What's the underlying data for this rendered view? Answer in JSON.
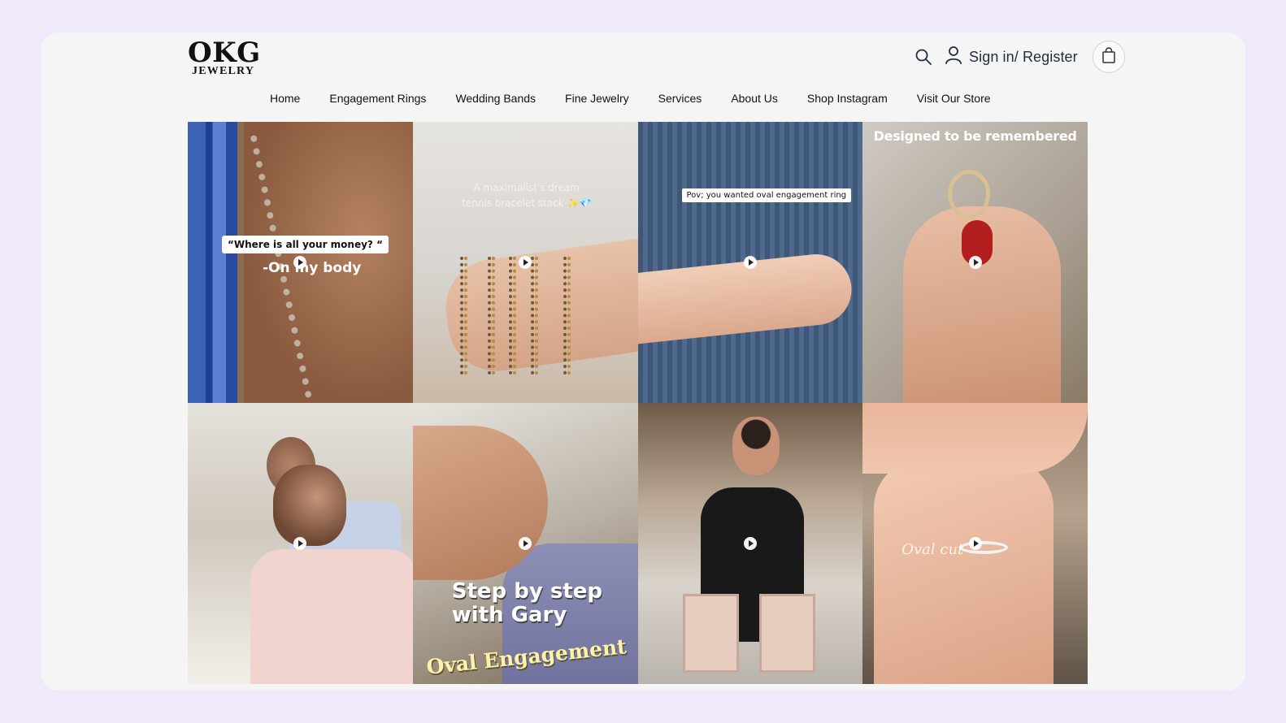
{
  "header": {
    "logo": {
      "line1": "OKG",
      "line2": "JEWELRY"
    },
    "account_label": "Sign in/ Register",
    "icons": {
      "search": "search-icon",
      "account": "user-icon",
      "cart": "shopping-bag-icon"
    }
  },
  "nav": {
    "items": [
      {
        "label": "Home"
      },
      {
        "label": "Engagement Rings"
      },
      {
        "label": "Wedding Bands"
      },
      {
        "label": "Fine Jewelry"
      },
      {
        "label": "Services"
      },
      {
        "label": "About Us"
      },
      {
        "label": "Shop Instagram"
      },
      {
        "label": "Visit Our Store"
      }
    ]
  },
  "grid": {
    "tiles": [
      {
        "caption1": "“Where is all your money? “",
        "caption2": "-On my body"
      },
      {
        "caption1": "A maximalist's dream tennis bracelet stack ✨💎"
      },
      {
        "caption1": "Pov; you wanted oval engagement ring"
      },
      {
        "caption1": "Designed to be remembered"
      },
      {},
      {
        "caption1": "Step by step with Gary",
        "caption2": "Oval Engagement"
      },
      {},
      {
        "caption1": "Oval cut"
      }
    ]
  },
  "colors": {
    "page_bg": "#efe9fb",
    "card_bg": "#f5f5f5",
    "text": "#111111",
    "account_text": "#1f2d3d"
  }
}
